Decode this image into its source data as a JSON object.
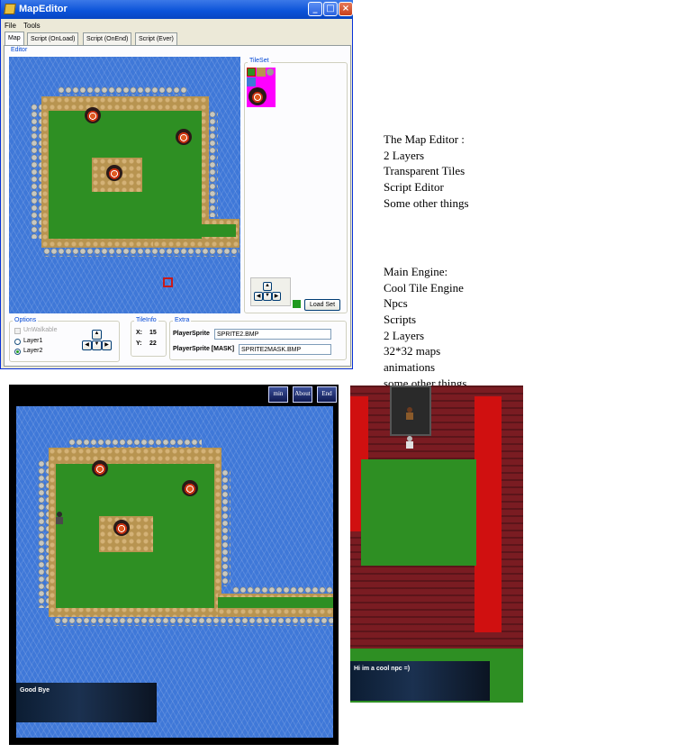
{
  "window": {
    "title": "MapEditor",
    "controls": {
      "minimize": "_",
      "maximize": "□",
      "close": "×"
    },
    "menu": [
      "File",
      "Tools"
    ],
    "tabs": [
      "Map",
      "Script (OnLoad)",
      "Script (OnEnd)",
      "Script (Ever)"
    ],
    "editor_label": "Editor",
    "tileset_label": "TileSet",
    "load_set_button": "Load Set",
    "options": {
      "label": "Options",
      "unwalkable": "UnWalkable",
      "layer1": "Layer1",
      "layer2": "Layer2",
      "selected_layer": "Layer2"
    },
    "tileinfo": {
      "label": "TileInfo",
      "x_label": "X:",
      "x_value": "15",
      "y_label": "Y:",
      "y_value": "22"
    },
    "extra": {
      "label": "Extra",
      "player_sprite_label": "PlayerSprite",
      "player_sprite_value": "SPRITE2.BMP",
      "player_sprite_mask_label": "PlayerSprite [MASK]",
      "player_sprite_mask_value": "SPRITE2MASK.BMP"
    },
    "selected_color": "#1f9a1f"
  },
  "notes": {
    "editor": [
      "The Map Editor :",
      "2 Layers",
      "Transparent Tiles",
      "Script Editor",
      "Some other things"
    ],
    "engine": [
      "Main Engine:",
      "Cool Tile Engine",
      "Npcs",
      "Scripts",
      "2 Layers",
      "32*32 maps",
      "animations",
      "some other things"
    ]
  },
  "game1": {
    "buttons": [
      "min",
      "About",
      "End"
    ],
    "dialog": "Good Bye"
  },
  "game2": {
    "dialog": "Hi im a cool npc =)"
  },
  "colors": {
    "water": "#3f78d8",
    "grass": "#2e8f23",
    "lava": "#d01010",
    "cave": "#7a1c22"
  }
}
